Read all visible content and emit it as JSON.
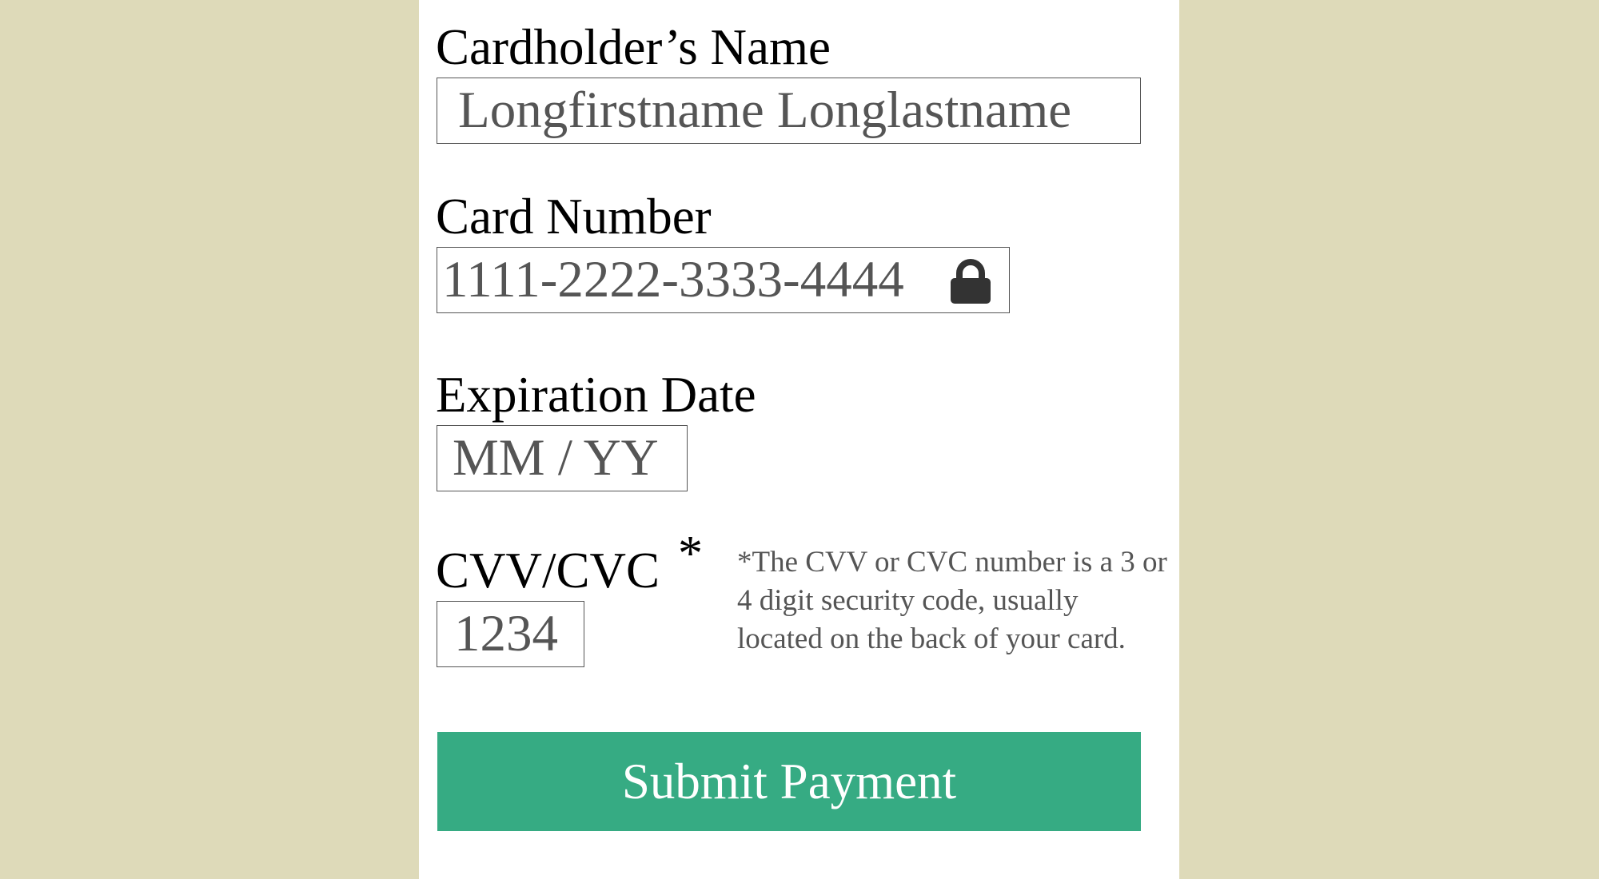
{
  "form": {
    "name": {
      "label": "Cardholder’s Name",
      "placeholder": "Longfirstname Longlastname"
    },
    "card_number": {
      "label": "Card Number",
      "placeholder": "1111-2222-3333-4444",
      "icon": "lock-icon"
    },
    "expiration": {
      "label": "Expiration Date",
      "placeholder": "MM / YY"
    },
    "cvv": {
      "label": "CVV/CVC",
      "asterisk": "*",
      "placeholder": "1234",
      "help_text": "*The CVV or CVC number is a 3 or 4 digit security code, usually located on the back of your card."
    },
    "submit_label": "Submit Payment"
  },
  "colors": {
    "background": "#dedab9",
    "panel": "#ffffff",
    "submit_button": "#36ab83",
    "field_text": "#555555",
    "label_text": "#000000"
  }
}
